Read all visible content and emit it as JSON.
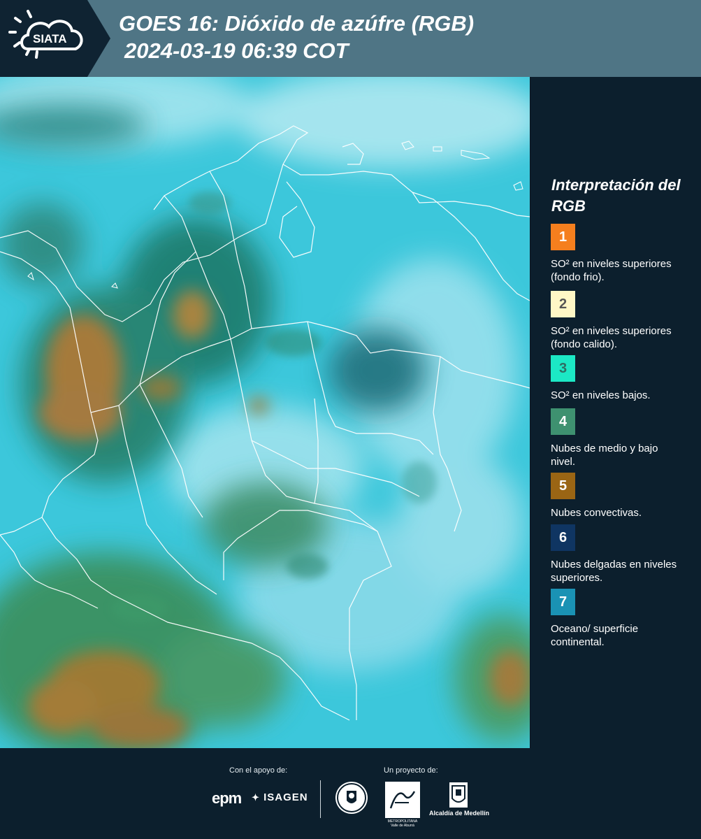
{
  "header": {
    "logo_text": "SIATA",
    "title_line1": "GOES 16: Dióxido de azúfre (RGB)",
    "title_line2": "2024-03-19 06:39 COT",
    "background_color": "#4f7585"
  },
  "legend": {
    "title": "Interpretación del RGB",
    "items": [
      {
        "number": "1",
        "color": "#f57f1e",
        "text_color": "#ffffff",
        "label": "SO² en niveles superiores (fondo frio)."
      },
      {
        "number": "2",
        "color": "#fff7c6",
        "text_color": "#555555",
        "label": "SO² en niveles superiores (fondo calido)."
      },
      {
        "number": "3",
        "color": "#1ce8c5",
        "text_color": "#2f6d63",
        "label": "SO² en niveles bajos."
      },
      {
        "number": "4",
        "color": "#3e9170",
        "text_color": "#ffffff",
        "label": "Nubes de medio y bajo nivel."
      },
      {
        "number": "5",
        "color": "#9a6514",
        "text_color": "#ffffff",
        "label": "Nubes convectivas."
      },
      {
        "number": "6",
        "color": "#0f3562",
        "text_color": "#ffffff",
        "label": "Nubes delgadas en niveles superiores."
      },
      {
        "number": "7",
        "color": "#1a92b4",
        "text_color": "#ffffff",
        "label": "Oceano/ superficie continental."
      }
    ]
  },
  "footer": {
    "support_caption": "Con el apoyo de:",
    "project_caption": "Un proyecto de:",
    "epm": "epm",
    "isagen": "ISAGEN",
    "area_metropolitana": "METROPOLITANA Valle de Aburrá",
    "alcaldia": "Alcaldía de Medellín"
  }
}
